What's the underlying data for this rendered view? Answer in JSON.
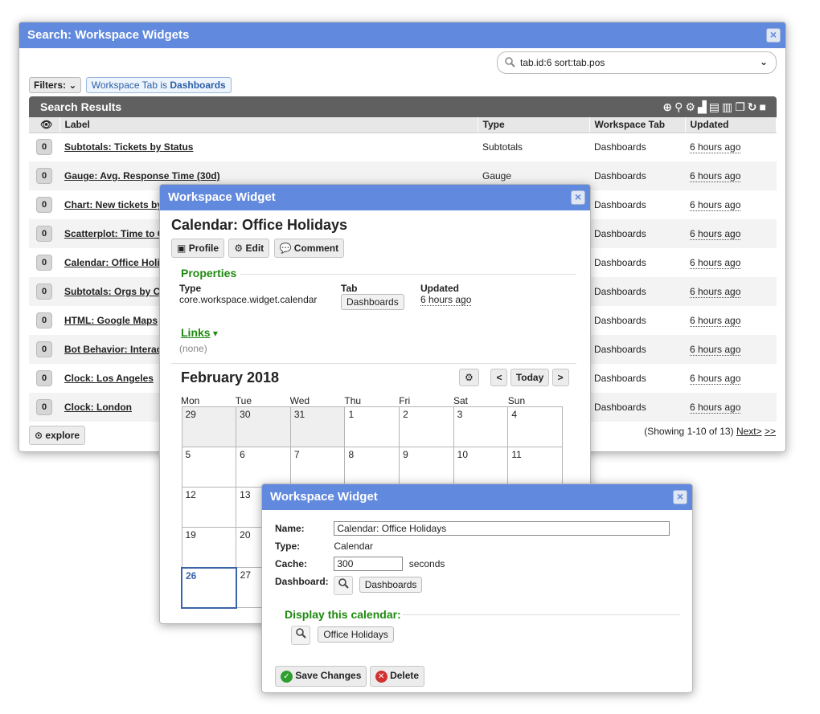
{
  "search": {
    "title": "Search: Workspace Widgets",
    "query": "tab.id:6 sort:tab.pos",
    "filters_label": "Filters:",
    "filter_tag_prefix": "Workspace Tab is",
    "filter_tag_value": "Dashboards",
    "results_title": "Search Results",
    "columns": [
      "Label",
      "Type",
      "Workspace Tab",
      "Updated"
    ],
    "rows": [
      {
        "label": "Subtotals: Tickets by Status",
        "type": "Subtotals",
        "tab": "Dashboards",
        "updated": "6 hours ago"
      },
      {
        "label": "Gauge: Avg. Response Time (30d)",
        "type": "Gauge",
        "tab": "Dashboards",
        "updated": "6 hours ago"
      },
      {
        "label": "Chart: New tickets by",
        "type": "",
        "tab": "Dashboards",
        "updated": "6 hours ago"
      },
      {
        "label": "Scatterplot: Time to C",
        "type": "",
        "tab": "Dashboards",
        "updated": "6 hours ago"
      },
      {
        "label": "Calendar: Office Holi",
        "type": "",
        "tab": "Dashboards",
        "updated": "6 hours ago"
      },
      {
        "label": "Subtotals: Orgs by Co",
        "type": "",
        "tab": "Dashboards",
        "updated": "6 hours ago"
      },
      {
        "label": "HTML: Google Maps",
        "type": "",
        "tab": "Dashboards",
        "updated": "6 hours ago"
      },
      {
        "label": "Bot Behavior: Interac",
        "type": "",
        "tab": "Dashboards",
        "updated": "6 hours ago"
      },
      {
        "label": "Clock: Los Angeles",
        "type": "",
        "tab": "Dashboards",
        "updated": "6 hours ago"
      },
      {
        "label": "Clock: London",
        "type": "",
        "tab": "Dashboards",
        "updated": "6 hours ago"
      }
    ],
    "watchers": "0",
    "explore_label": "explore",
    "paging_text": "(Showing 1-10 of 13)",
    "next_label": "Next>",
    "last_label": ">>"
  },
  "widget": {
    "title": "Workspace Widget",
    "heading": "Calendar: Office Holidays",
    "actions": [
      "Profile",
      "Edit",
      "Comment"
    ],
    "properties_label": "Properties",
    "type_label": "Type",
    "type_value": "core.workspace.widget.calendar",
    "tab_label": "Tab",
    "tab_value": "Dashboards",
    "updated_label": "Updated",
    "updated_value": "6 hours ago",
    "links_label": "Links",
    "links_value": "(none)",
    "calendar": {
      "month": "February 2018",
      "today_label": "Today",
      "prev_label": "<",
      "next_label": ">",
      "days": [
        "Mon",
        "Tue",
        "Wed",
        "Thu",
        "Fri",
        "Sat",
        "Sun"
      ],
      "weeks": [
        [
          "29",
          "30",
          "31",
          "1",
          "2",
          "3",
          "4"
        ],
        [
          "5",
          "6",
          "7",
          "8",
          "9",
          "10",
          "11"
        ],
        [
          "12",
          "13",
          "",
          "",
          "",
          "",
          ""
        ],
        [
          "19",
          "20",
          "",
          "",
          "",
          "",
          ""
        ],
        [
          "26",
          "27",
          "",
          "",
          "",
          "",
          ""
        ]
      ]
    }
  },
  "edit": {
    "title": "Workspace Widget",
    "name_label": "Name:",
    "name_value": "Calendar: Office Holidays",
    "type_label": "Type:",
    "type_value": "Calendar",
    "cache_label": "Cache:",
    "cache_value": "300",
    "cache_unit": "seconds",
    "dashboard_label": "Dashboard:",
    "dashboard_value": "Dashboards",
    "display_label": "Display this calendar:",
    "display_value": "Office Holidays",
    "save_label": "Save Changes",
    "delete_label": "Delete"
  },
  "colors": {
    "title_bar": "#6189dd",
    "section_green": "#1d8a0f",
    "results_bar": "#606060"
  }
}
